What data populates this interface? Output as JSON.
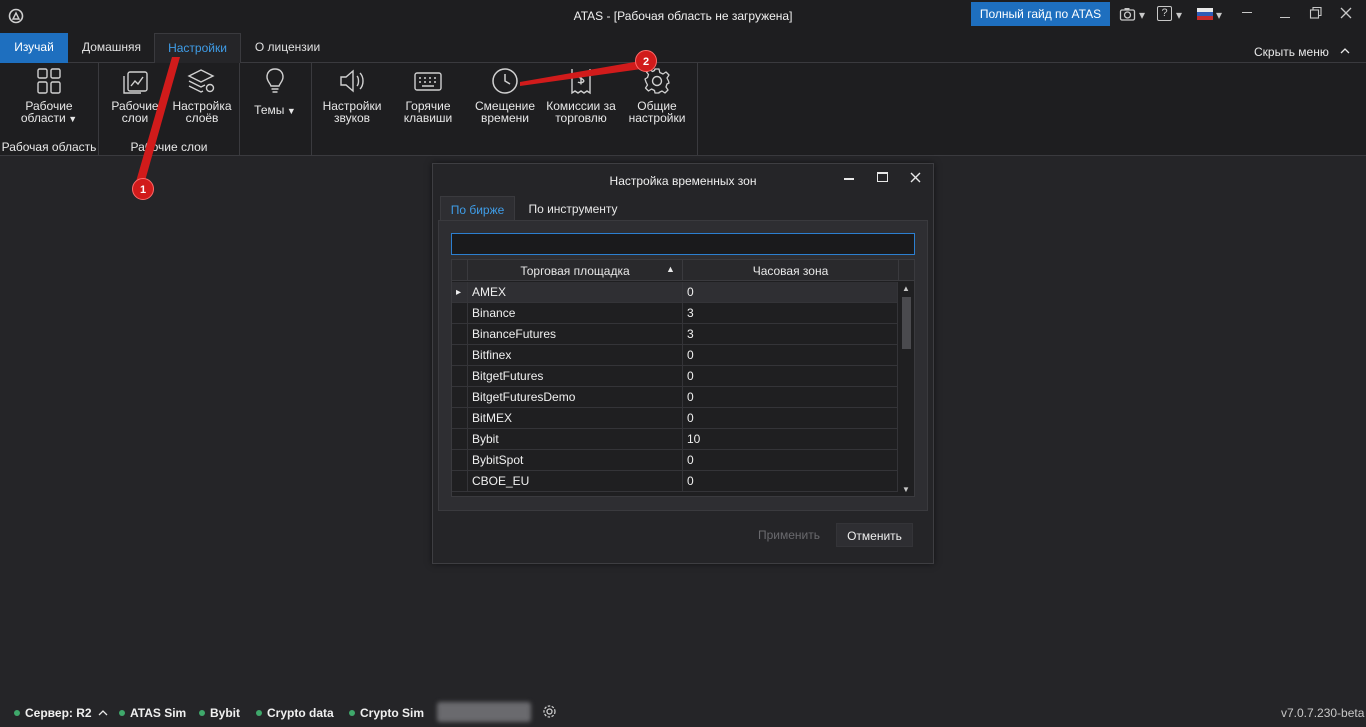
{
  "window": {
    "title": "ATAS - [Рабочая область не загружена]",
    "guide_button": "Полный гайд по ATAS",
    "help_label": "?",
    "hide_menu": "Скрыть меню"
  },
  "menu": {
    "tabs": [
      "Изучай",
      "Домашняя",
      "Настройки",
      "О лицензии"
    ],
    "active": "Настройки"
  },
  "ribbon": {
    "workspaces": {
      "line1": "Рабочие",
      "line2": "области"
    },
    "work_layers": {
      "line1": "Рабочие",
      "line2": "слои"
    },
    "layer_settings": {
      "line1": "Настройка",
      "line2": "слоёв"
    },
    "themes": {
      "line1": "Темы"
    },
    "sounds": {
      "line1": "Настройки",
      "line2": "звуков"
    },
    "hotkeys": {
      "line1": "Горячие",
      "line2": "клавиши"
    },
    "time_offset": {
      "line1": "Смещение",
      "line2": "времени"
    },
    "commissions": {
      "line1": "Комиссии за",
      "line2": "торговлю"
    },
    "general": {
      "line1": "Общие",
      "line2": "настройки"
    },
    "group_workspace": "Рабочая область",
    "group_layers": "Рабочие слои"
  },
  "dialog": {
    "title": "Настройка временных зон",
    "tab_exchange": "По бирже",
    "tab_instrument": "По инструменту",
    "search_value": "",
    "col_venue": "Торговая площадка",
    "col_tz": "Часовая зона",
    "rows": [
      {
        "venue": "AMEX",
        "tz": "0"
      },
      {
        "venue": "Binance",
        "tz": "3"
      },
      {
        "venue": "BinanceFutures",
        "tz": "3"
      },
      {
        "venue": "Bitfinex",
        "tz": "0"
      },
      {
        "venue": "BitgetFutures",
        "tz": "0"
      },
      {
        "venue": "BitgetFuturesDemo",
        "tz": "0"
      },
      {
        "venue": "BitMEX",
        "tz": "0"
      },
      {
        "venue": "Bybit",
        "tz": "10"
      },
      {
        "venue": "BybitSpot",
        "tz": "0"
      },
      {
        "venue": "CBOE_EU",
        "tz": "0"
      }
    ],
    "apply": "Применить",
    "cancel": "Отменить"
  },
  "status": {
    "server": "Сервер: R2",
    "conn1": "ATAS Sim",
    "conn2": "Bybit",
    "conn3": "Crypto data",
    "conn4": "Crypto Sim",
    "version": "v7.0.7.230-beta"
  },
  "annotations": {
    "m1": "1",
    "m2": "2"
  },
  "colors": {
    "accent": "#1e6fbf",
    "active_tab_text": "#3f9de8",
    "marker": "#d11b1b",
    "online": "#3fa86b"
  }
}
